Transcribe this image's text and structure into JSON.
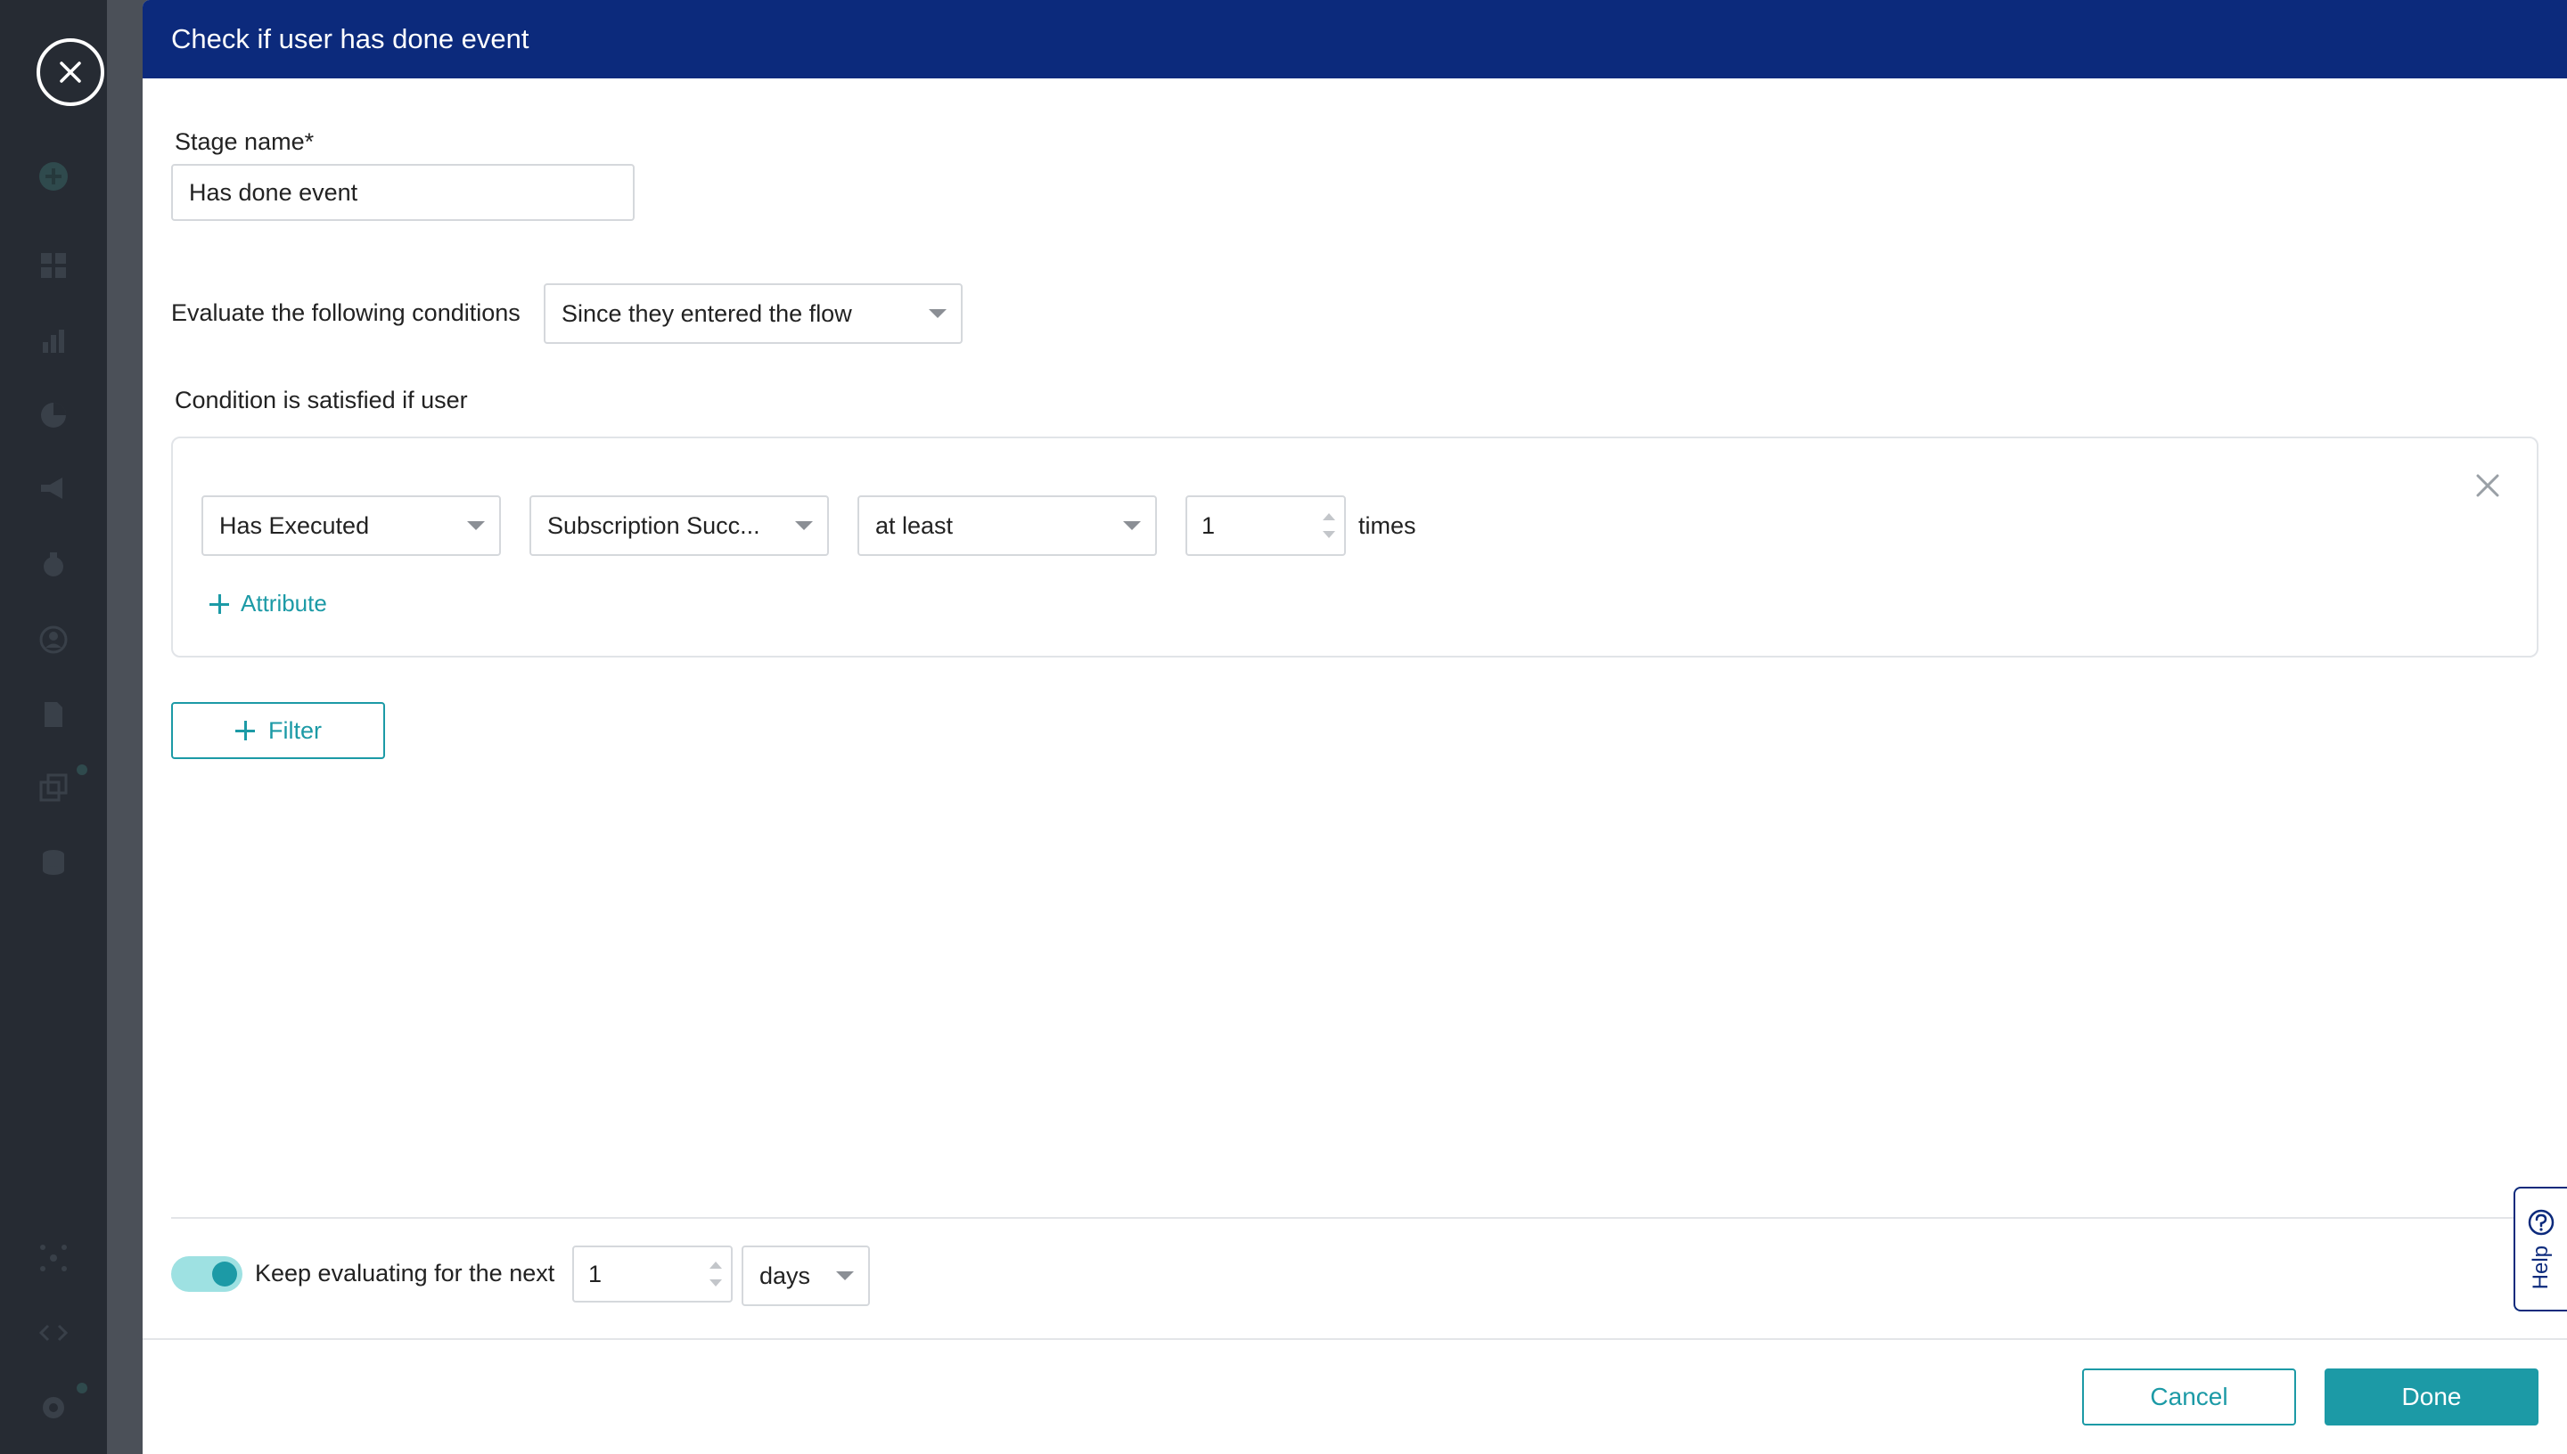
{
  "modal": {
    "title": "Check if user has done event"
  },
  "stage": {
    "label": "Stage name*",
    "value": "Has done event"
  },
  "evaluate": {
    "label": "Evaluate the following conditions",
    "selected": "Since they entered the flow"
  },
  "condition": {
    "label": "Condition is satisfied if user",
    "action": "Has Executed",
    "event": "Subscription Succ...",
    "comparator": "at least",
    "count": "1",
    "unit": "times",
    "add_attribute_label": "Attribute"
  },
  "filter": {
    "label": "Filter"
  },
  "keep_evaluating": {
    "enabled": true,
    "label": "Keep evaluating for the next",
    "value": "1",
    "unit": "days"
  },
  "footer": {
    "cancel_label": "Cancel",
    "done_label": "Done"
  },
  "help": {
    "label": "Help"
  },
  "colors": {
    "header": "#0c2a7c",
    "accent": "#1c9aa6",
    "toggle_track": "#9ee1e2"
  }
}
